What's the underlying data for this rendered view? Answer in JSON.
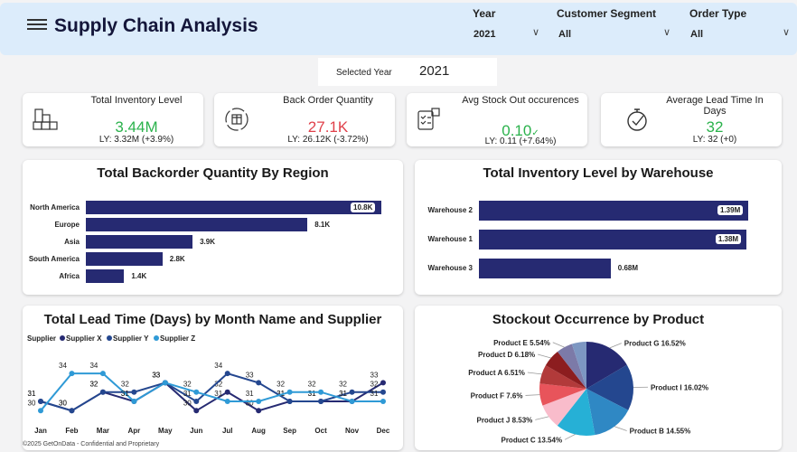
{
  "header": {
    "title": "Supply Chain Analysis",
    "filters": [
      {
        "label": "Year",
        "value": "2021"
      },
      {
        "label": "Customer Segment",
        "value": "All"
      },
      {
        "label": "Order Type",
        "value": "All"
      }
    ]
  },
  "selected_year": {
    "label": "Selected Year",
    "value": "2021"
  },
  "kpis": [
    {
      "title": "Total Inventory Level",
      "value": "3.44M",
      "ly": "LY: 3.32M (+3.9%)",
      "color": "#2bb24c",
      "icon": "warehouse-boxes-icon"
    },
    {
      "title": "Back Order Quantity",
      "value": "27.1K",
      "ly": "LY: 26.12K (-3.72%)",
      "color": "#e0404a",
      "icon": "box-cycle-icon"
    },
    {
      "title": "Avg Stock Out occurences",
      "value": "0.10",
      "ly": "LY: 0.11 (+7.64%)",
      "color": "#2bb24c",
      "icon": "checklist-box-icon",
      "check": "✓"
    },
    {
      "title": "Average Lead Time In Days",
      "value": "32",
      "ly": "LY: 32 (+0)",
      "color": "#2bb24c",
      "icon": "stopwatch-icon"
    }
  ],
  "chart_data": [
    {
      "type": "bar",
      "title": "Total Backorder Quantity By Region",
      "categories": [
        "North America",
        "Europe",
        "Asia",
        "South America",
        "Africa"
      ],
      "values": [
        10.8,
        8.1,
        3.9,
        2.8,
        1.4
      ],
      "labels": [
        "10.8K",
        "8.1K",
        "3.9K",
        "2.8K",
        "1.4K"
      ],
      "unit": "K",
      "color": "#262a72"
    },
    {
      "type": "bar",
      "title": "Total Inventory Level by Warehouse",
      "categories": [
        "Warehouse 2",
        "Warehouse 1",
        "Warehouse 3"
      ],
      "values": [
        1.39,
        1.38,
        0.68
      ],
      "labels": [
        "1.39M",
        "1.38M",
        "0.68M"
      ],
      "unit": "M",
      "color": "#262a72"
    },
    {
      "type": "line",
      "title": "Total Lead Time (Days) by Month Name and Supplier",
      "legend_title": "Supplier",
      "x": [
        "Jan",
        "Feb",
        "Mar",
        "Apr",
        "May",
        "Jun",
        "Jul",
        "Aug",
        "Sep",
        "Oct",
        "Nov",
        "Dec"
      ],
      "series": [
        {
          "name": "Supplier X",
          "color": "#262a72",
          "values": [
            31,
            30,
            32,
            31,
            33,
            30,
            32,
            30,
            31,
            31,
            31,
            33
          ]
        },
        {
          "name": "Supplier Y",
          "color": "#24478f",
          "values": [
            31,
            30,
            32,
            32,
            33,
            31,
            34,
            33,
            31,
            31,
            32,
            32
          ]
        },
        {
          "name": "Supplier Z",
          "color": "#2f9ad6",
          "values": [
            30,
            34,
            34,
            31,
            33,
            32,
            31,
            31,
            32,
            32,
            31,
            31
          ]
        }
      ],
      "ylim": [
        29.5,
        34.5
      ]
    },
    {
      "type": "pie",
      "title": "Stockout Occurrence by Product",
      "slices": [
        {
          "label": "Product G 16.52%",
          "value": 16.52,
          "color": "#262a72"
        },
        {
          "label": "Product I 16.02%",
          "value": 16.02,
          "color": "#24478f"
        },
        {
          "label": "Product B 14.55%",
          "value": 14.55,
          "color": "#2f88c4"
        },
        {
          "label": "Product C 13.54%",
          "value": 13.54,
          "color": "#26b0d6"
        },
        {
          "label": "Product J 8.53%",
          "value": 8.53,
          "color": "#f9bccb"
        },
        {
          "label": "Product F 7.6%",
          "value": 7.6,
          "color": "#e8545b"
        },
        {
          "label": "Product A 6.51%",
          "value": 6.51,
          "color": "#b23a3a"
        },
        {
          "label": "Product D 6.18%",
          "value": 6.18,
          "color": "#8c1d1f"
        },
        {
          "label": "Product E 5.54%",
          "value": 5.54,
          "color": "#7c7aa8"
        },
        {
          "label": null,
          "value": 5.01,
          "color": "#7d97c2"
        }
      ]
    }
  ],
  "footer": "©2025 GetOnData - Confidential and Proprietary"
}
